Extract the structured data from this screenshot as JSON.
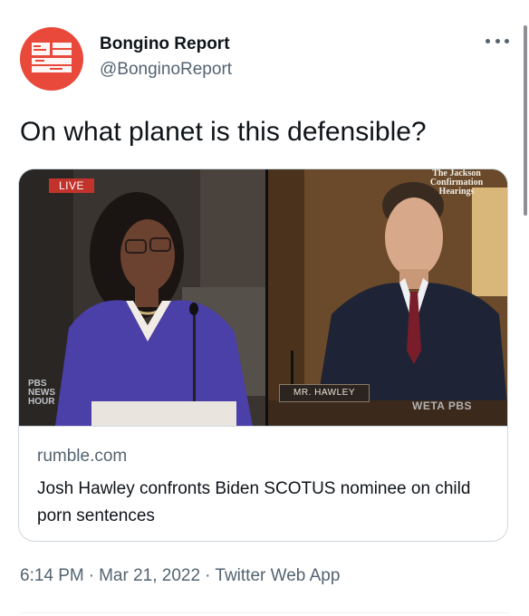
{
  "account": {
    "display_name": "Bongino Report",
    "handle": "@BonginoReport"
  },
  "tweet": {
    "text": "On what planet is this defensible?"
  },
  "link_card": {
    "media": {
      "live_badge": "LIVE",
      "series_title": "The Jackson Confirmation Hearings",
      "nameplate": "MR. HAWLEY",
      "network_bug": "PBS NEWS HOUR",
      "station_bug": "WETA PBS"
    },
    "domain": "rumble.com",
    "title": "Josh Hawley confronts Biden SCOTUS nominee on child porn sentences"
  },
  "meta": {
    "time": "6:14 PM",
    "date": "Mar 21, 2022",
    "source": "Twitter Web App"
  },
  "colors": {
    "avatar_bg": "#e8493a",
    "text_primary": "#0f1419",
    "text_secondary": "#536471",
    "border": "#cfd9de",
    "live_red": "#c2332c"
  }
}
